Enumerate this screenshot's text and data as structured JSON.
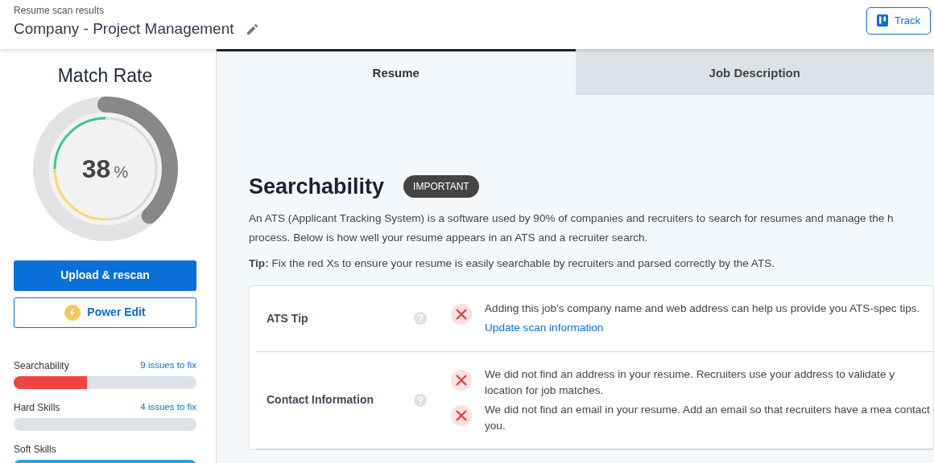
{
  "header": {
    "subtitle": "Resume scan results",
    "title": "Company - Project Management",
    "track_button": "Track"
  },
  "sidebar": {
    "heading": "Match Rate",
    "score": {
      "value": "38",
      "unit": "%",
      "level": 0.38
    },
    "buttons": [
      {
        "label": "Upload & rescan",
        "kind": "primary"
      },
      {
        "label": "Power Edit",
        "kind": "outline"
      }
    ],
    "categories": [
      {
        "name": "Searchability",
        "issues": "9 issues to fix",
        "level": 0.4,
        "color": "#ef4444"
      },
      {
        "name": "Hard Skills",
        "issues": "4 issues to fix"
      },
      {
        "name": "Soft Skills",
        "level": 1,
        "color": "#2aa3e0"
      }
    ]
  },
  "tabs": [
    {
      "label": "Resume",
      "selected": true
    },
    {
      "label": "Job Description",
      "selected": false
    }
  ],
  "section": {
    "title": "Searchability",
    "badge": "IMPORTANT",
    "description": "An ATS (Applicant Tracking System) is a software used by 90% of companies and recruiters to search for resumes and manage the h process. Below is how well your resume appears in an ATS and a recruiter search.",
    "tip": "**Tip:** Fix the red Xs to ensure your resume is easily searchable by recruiters and parsed correctly by the ATS.",
    "rows": [
      {
        "label": "ATS Tip",
        "checks": [
          {
            "text": "Adding this job's company name and web address can help us provide you ATS-spec tips.",
            "link": "Update scan information"
          }
        ]
      },
      {
        "label": "Contact Information",
        "checks": [
          {
            "text": "We did not find an address in your resume. Recruiters use your address to validate y location for job matches."
          },
          {
            "text": "We did not find an email in your resume. Add an email so that recruiters have a mea contact you."
          }
        ]
      }
    ]
  }
}
